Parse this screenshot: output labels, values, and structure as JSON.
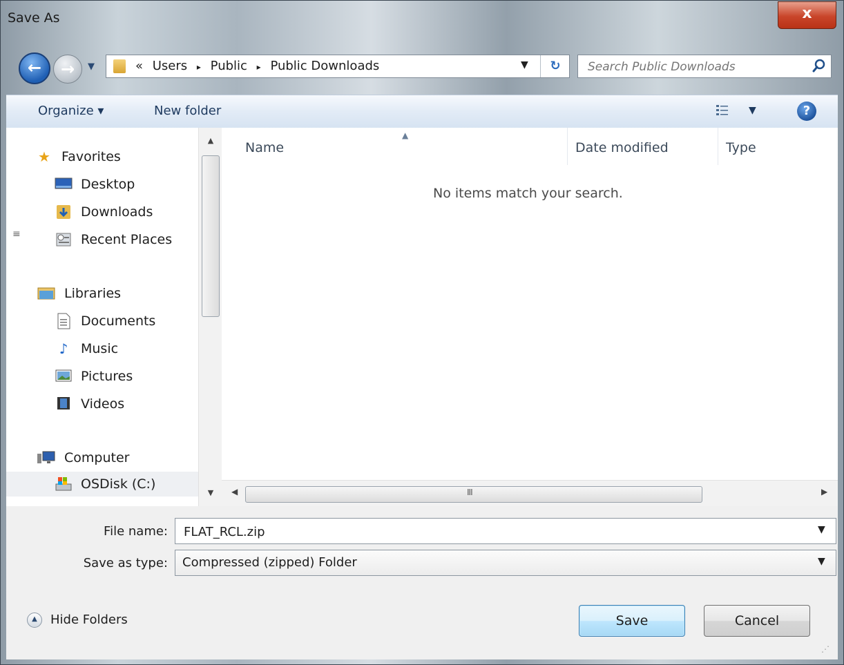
{
  "window": {
    "title": "Save As",
    "close_symbol": "x"
  },
  "nav": {
    "back_symbol": "←",
    "forward_symbol": "→",
    "address": {
      "overflow": "«",
      "crumbs": [
        "Users",
        "Public",
        "Public Downloads"
      ],
      "separator": "▸"
    },
    "search": {
      "placeholder": "Search Public Downloads"
    }
  },
  "toolbar": {
    "organize_label": "Organize ▾",
    "new_folder_label": "New folder",
    "help_symbol": "?"
  },
  "sidebar": {
    "items": [
      {
        "label": "Favorites",
        "icon": "star-icon"
      },
      {
        "label": "Desktop",
        "icon": "desktop-icon"
      },
      {
        "label": "Downloads",
        "icon": "downloads-icon"
      },
      {
        "label": "Recent Places",
        "icon": "recent-places-icon"
      },
      {
        "label": "Libraries",
        "icon": "libraries-icon"
      },
      {
        "label": "Documents",
        "icon": "documents-icon"
      },
      {
        "label": "Music",
        "icon": "music-icon"
      },
      {
        "label": "Pictures",
        "icon": "pictures-icon"
      },
      {
        "label": "Videos",
        "icon": "videos-icon"
      },
      {
        "label": "Computer",
        "icon": "computer-icon"
      },
      {
        "label": "OSDisk (C:)",
        "icon": "drive-icon"
      }
    ]
  },
  "file_list": {
    "columns": [
      "Name",
      "Date modified",
      "Type"
    ],
    "empty_message": "No items match your search.",
    "scroll_grip": "III"
  },
  "form": {
    "file_name_label": "File name:",
    "file_name_value": "FLAT_RCL.zip",
    "save_type_label": "Save as type:",
    "save_type_value": "Compressed (zipped) Folder"
  },
  "footer": {
    "hide_folders_label": "Hide Folders",
    "save_label": "Save",
    "cancel_label": "Cancel"
  },
  "colors": {
    "accent": "#3c7fb1",
    "close": "#c9452a",
    "toolbar": "#dfe9f5"
  }
}
